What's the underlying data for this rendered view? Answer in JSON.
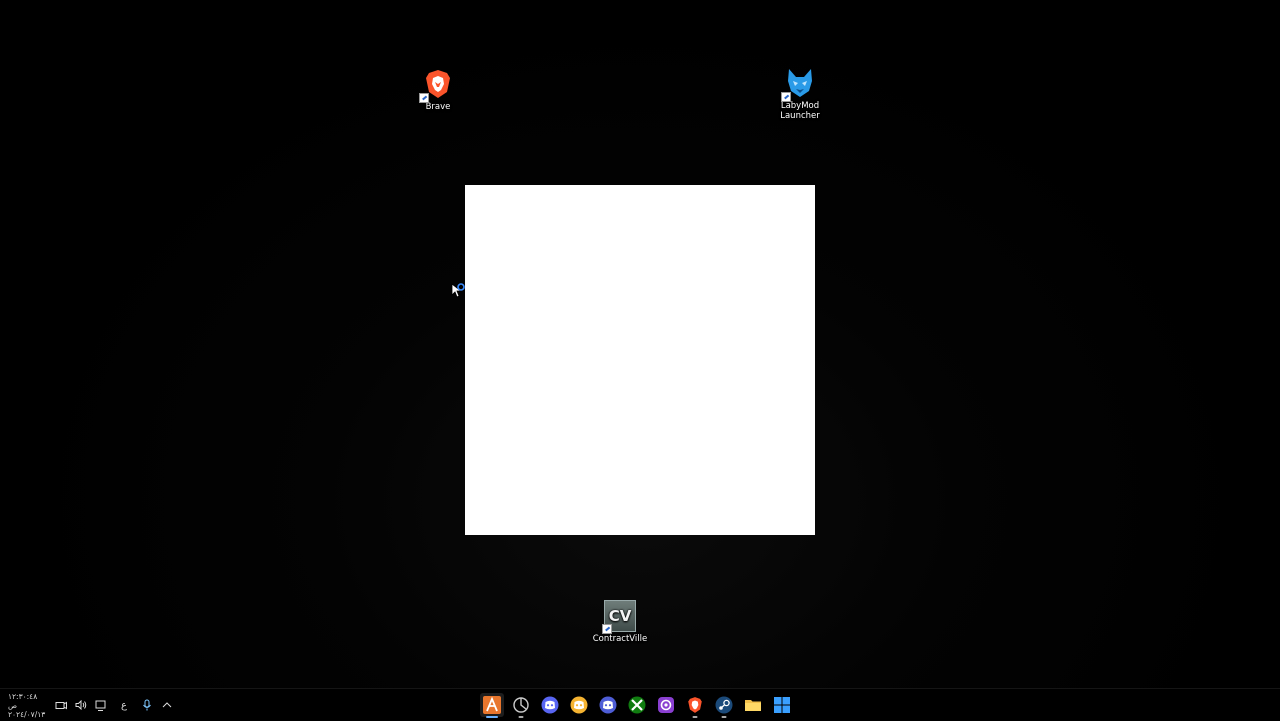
{
  "desktop": {
    "icons": [
      {
        "label": "Brave",
        "icon": "brave-lion-icon"
      },
      {
        "label_line1": "LabyMod",
        "label_line2": "Launcher",
        "icon": "labymod-wolf-icon"
      },
      {
        "label": "ContractVille",
        "icon_text": "CV",
        "icon": "contractville-icon"
      }
    ],
    "splash_window": {
      "color": "#ffffff"
    }
  },
  "taskbar": {
    "clock": {
      "time": "١٢:٣٠:٤٨ ص",
      "date": "٢٠٢٤/٠٧/١٣"
    },
    "tray": {
      "language": "ع",
      "icons": [
        "camera-icon",
        "speaker-icon",
        "network-icon",
        "microphone-icon",
        "chevron-up-icon"
      ]
    },
    "apps": [
      {
        "name": "launcher-app-icon",
        "active": true
      },
      {
        "name": "steelseries-app-icon"
      },
      {
        "name": "discord-app-icon"
      },
      {
        "name": "discord-canary-app-icon"
      },
      {
        "name": "discord-ptb-app-icon"
      },
      {
        "name": "xbox-app-icon"
      },
      {
        "name": "obs-app-icon"
      },
      {
        "name": "brave-app-icon"
      },
      {
        "name": "steam-app-icon"
      },
      {
        "name": "file-explorer-app-icon"
      },
      {
        "name": "start-app-icon"
      }
    ]
  },
  "colors": {
    "accent": "#6cb2ff",
    "brave": "#fb542b",
    "discord": "#5865f2",
    "xbox": "#107c10"
  }
}
